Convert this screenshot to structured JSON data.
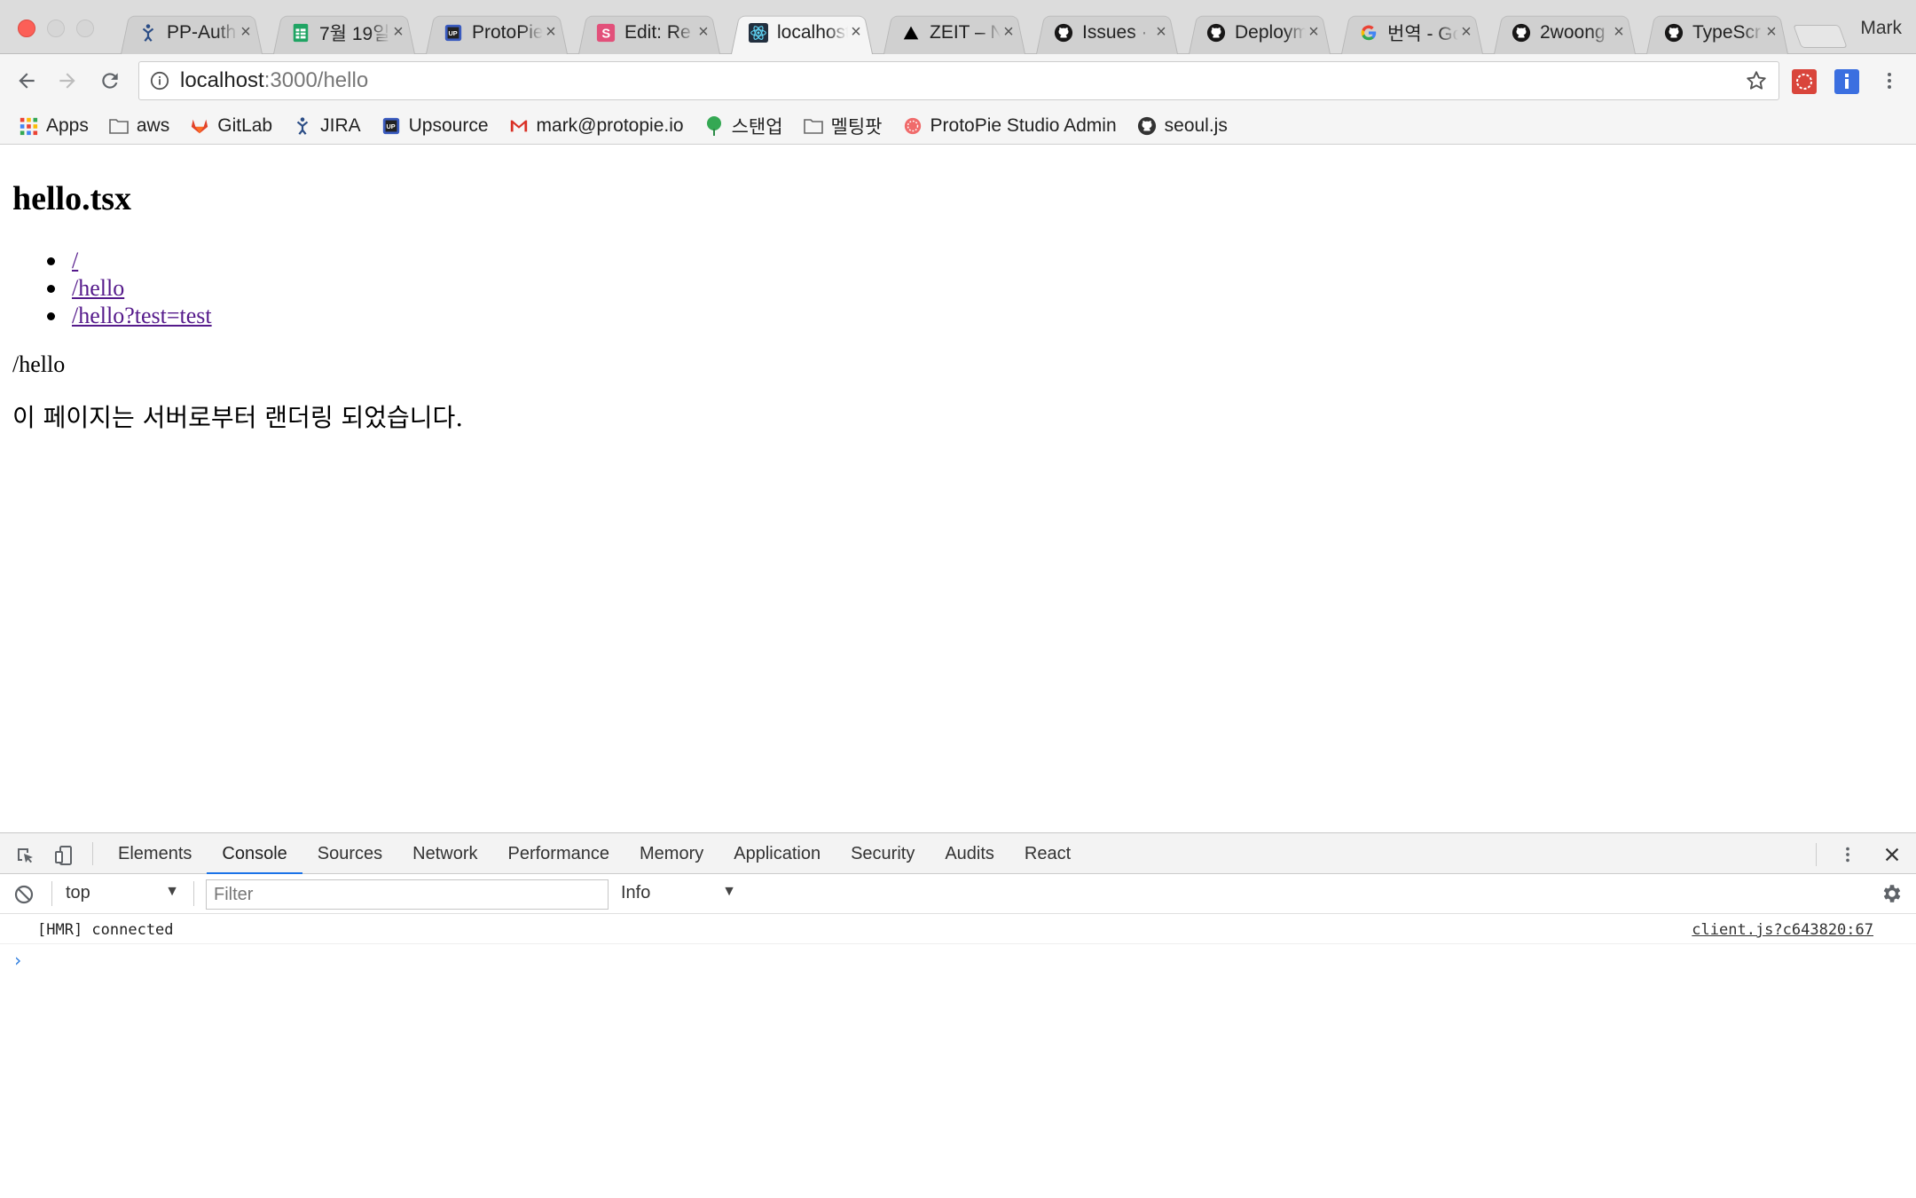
{
  "window": {
    "profile_name": "Mark",
    "tabs": [
      {
        "title": "PP-Auth",
        "icon": "jira-icon",
        "color": "#2b4d86"
      },
      {
        "title": "7월 19일",
        "icon": "sheets-icon",
        "color": "#1fa463"
      },
      {
        "title": "ProtoPie",
        "icon": "upsource-icon",
        "color": "#3a5bbf"
      },
      {
        "title": "Edit: Re",
        "icon": "s-icon",
        "color": "#e2507a"
      },
      {
        "title": "localhost",
        "icon": "react-icon",
        "color": "#222f3e",
        "active": true
      },
      {
        "title": "ZEIT – N",
        "icon": "zeit-icon",
        "color": "#000000"
      },
      {
        "title": "Issues · ",
        "icon": "github-icon",
        "color": "#181717"
      },
      {
        "title": "Deploym",
        "icon": "github-icon",
        "color": "#181717"
      },
      {
        "title": "번역 - Go",
        "icon": "google-icon",
        "color": "#4285f4"
      },
      {
        "title": "2woong",
        "icon": "github-icon",
        "color": "#181717"
      },
      {
        "title": "TypeScr",
        "icon": "github-icon",
        "color": "#181717"
      }
    ]
  },
  "toolbar": {
    "url_host": "localhost",
    "url_path": ":3000/hello"
  },
  "bookmarks": [
    {
      "label": "Apps",
      "icon": "apps-grid-icon"
    },
    {
      "label": "aws",
      "icon": "folder-icon"
    },
    {
      "label": "GitLab",
      "icon": "gitlab-icon"
    },
    {
      "label": "JIRA",
      "icon": "jira-icon"
    },
    {
      "label": "Upsource",
      "icon": "upsource-icon"
    },
    {
      "label": "mark@protopie.io",
      "icon": "gmail-icon"
    },
    {
      "label": "스탠업",
      "icon": "leaf-icon"
    },
    {
      "label": "멜팅팟",
      "icon": "folder-icon"
    },
    {
      "label": "ProtoPie Studio Admin",
      "icon": "protopie-icon"
    },
    {
      "label": "seoul.js",
      "icon": "github-icon"
    }
  ],
  "page": {
    "heading": "hello.tsx",
    "links": [
      "/",
      "/hello",
      "/hello?test=test"
    ],
    "pathname": "/hello",
    "notice": "이 페이지는 서버로부터 랜더링 되었습니다."
  },
  "devtools": {
    "tabs": [
      "Elements",
      "Console",
      "Sources",
      "Network",
      "Performance",
      "Memory",
      "Application",
      "Security",
      "Audits",
      "React"
    ],
    "active_tab": "Console",
    "context": "top",
    "filter_placeholder": "Filter",
    "level": "Info",
    "messages": [
      {
        "text": "[HMR] connected",
        "source": "client.js?c643820:67"
      }
    ],
    "accent": "#1a73e8"
  }
}
